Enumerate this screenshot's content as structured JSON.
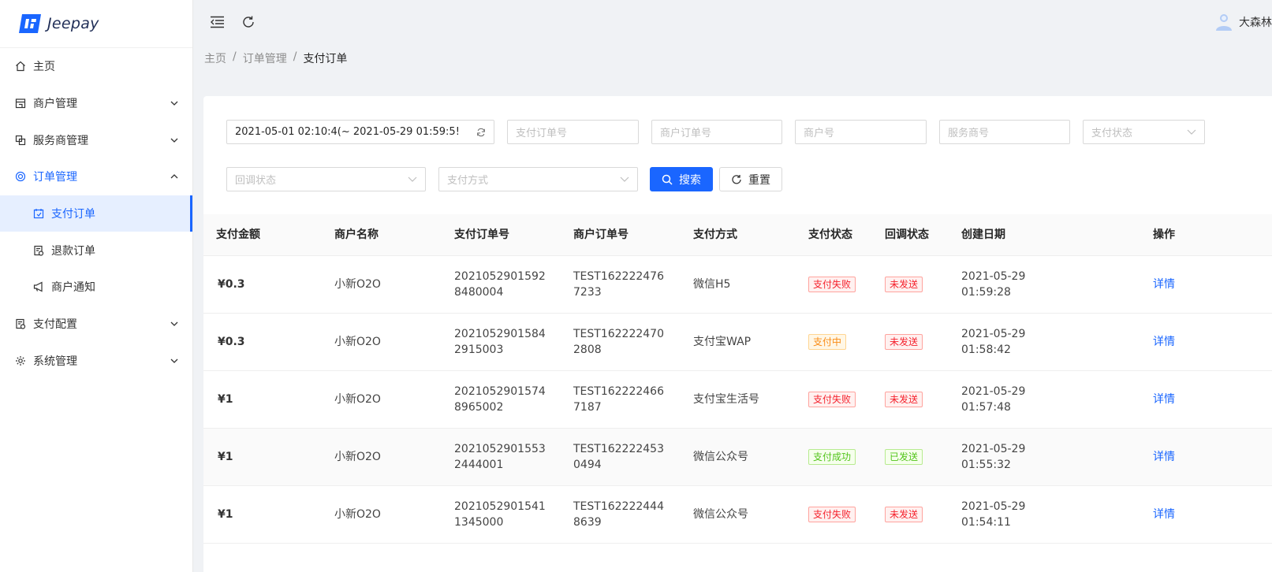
{
  "app": {
    "logo_text": "Jeepay"
  },
  "sidebar": {
    "items": [
      {
        "label": "主页",
        "icon": "home-icon"
      },
      {
        "label": "商户管理",
        "icon": "shop-icon"
      },
      {
        "label": "服务商管理",
        "icon": "partner-icon"
      },
      {
        "label": "订单管理",
        "icon": "order-icon"
      },
      {
        "label": "支付配置",
        "icon": "pay-config-icon"
      },
      {
        "label": "系统管理",
        "icon": "settings-icon"
      }
    ],
    "sub_items": [
      {
        "label": "支付订单",
        "icon": "pay-order-icon"
      },
      {
        "label": "退款订单",
        "icon": "refund-order-icon"
      },
      {
        "label": "商户通知",
        "icon": "notify-icon"
      }
    ]
  },
  "header": {
    "username": "大森林"
  },
  "breadcrumb": {
    "home": "主页",
    "parent": "订单管理",
    "current": "支付订单"
  },
  "filters": {
    "date_range": "2021-05-01 02:10:4(~ 2021-05-29 01:59:5!",
    "pay_order_no_placeholder": "支付订单号",
    "mch_order_no_placeholder": "商户订单号",
    "mch_no_placeholder": "商户号",
    "isv_no_placeholder": "服务商号",
    "pay_state_placeholder": "支付状态",
    "notify_state_placeholder": "回调状态",
    "way_code_placeholder": "支付方式",
    "search_label": "搜索",
    "reset_label": "重置"
  },
  "table": {
    "columns": [
      "支付金额",
      "商户名称",
      "支付订单号",
      "商户订单号",
      "支付方式",
      "支付状态",
      "回调状态",
      "创建日期",
      "操作"
    ],
    "rows": [
      {
        "amount": "¥0.3",
        "mch_name": "小新O2O",
        "pay_no_1": "2021052901592",
        "pay_no_2": "8480004",
        "mch_no_1": "TEST162222476",
        "mch_no_2": "7233",
        "way": "微信H5",
        "pay_state": "支付失败",
        "pay_tag": "red",
        "notify": "未发送",
        "notify_tag": "red",
        "date": "2021-05-29",
        "time": "01:59:28",
        "action": "详情"
      },
      {
        "amount": "¥0.3",
        "mch_name": "小新O2O",
        "pay_no_1": "2021052901584",
        "pay_no_2": "2915003",
        "mch_no_1": "TEST162222470",
        "mch_no_2": "2808",
        "way": "支付宝WAP",
        "pay_state": "支付中",
        "pay_tag": "orange",
        "notify": "未发送",
        "notify_tag": "red",
        "date": "2021-05-29",
        "time": "01:58:42",
        "action": "详情"
      },
      {
        "amount": "¥1",
        "mch_name": "小新O2O",
        "pay_no_1": "2021052901574",
        "pay_no_2": "8965002",
        "mch_no_1": "TEST162222466",
        "mch_no_2": "7187",
        "way": "支付宝生活号",
        "pay_state": "支付失败",
        "pay_tag": "red",
        "notify": "未发送",
        "notify_tag": "red",
        "date": "2021-05-29",
        "time": "01:57:48",
        "action": "详情"
      },
      {
        "amount": "¥1",
        "mch_name": "小新O2O",
        "pay_no_1": "2021052901553",
        "pay_no_2": "2444001",
        "mch_no_1": "TEST162222453",
        "mch_no_2": "0494",
        "way": "微信公众号",
        "pay_state": "支付成功",
        "pay_tag": "green",
        "notify": "已发送",
        "notify_tag": "green",
        "date": "2021-05-29",
        "time": "01:55:32",
        "action": "详情"
      },
      {
        "amount": "¥1",
        "mch_name": "小新O2O",
        "pay_no_1": "2021052901541",
        "pay_no_2": "1345000",
        "mch_no_1": "TEST162222444",
        "mch_no_2": "8639",
        "way": "微信公众号",
        "pay_state": "支付失败",
        "pay_tag": "red",
        "notify": "未发送",
        "notify_tag": "red",
        "date": "2021-05-29",
        "time": "01:54:11",
        "action": "详情"
      }
    ]
  },
  "colors": {
    "primary": "#1a66ff",
    "danger": "#f5222d",
    "warning": "#fa8c16",
    "success": "#52c41a"
  }
}
